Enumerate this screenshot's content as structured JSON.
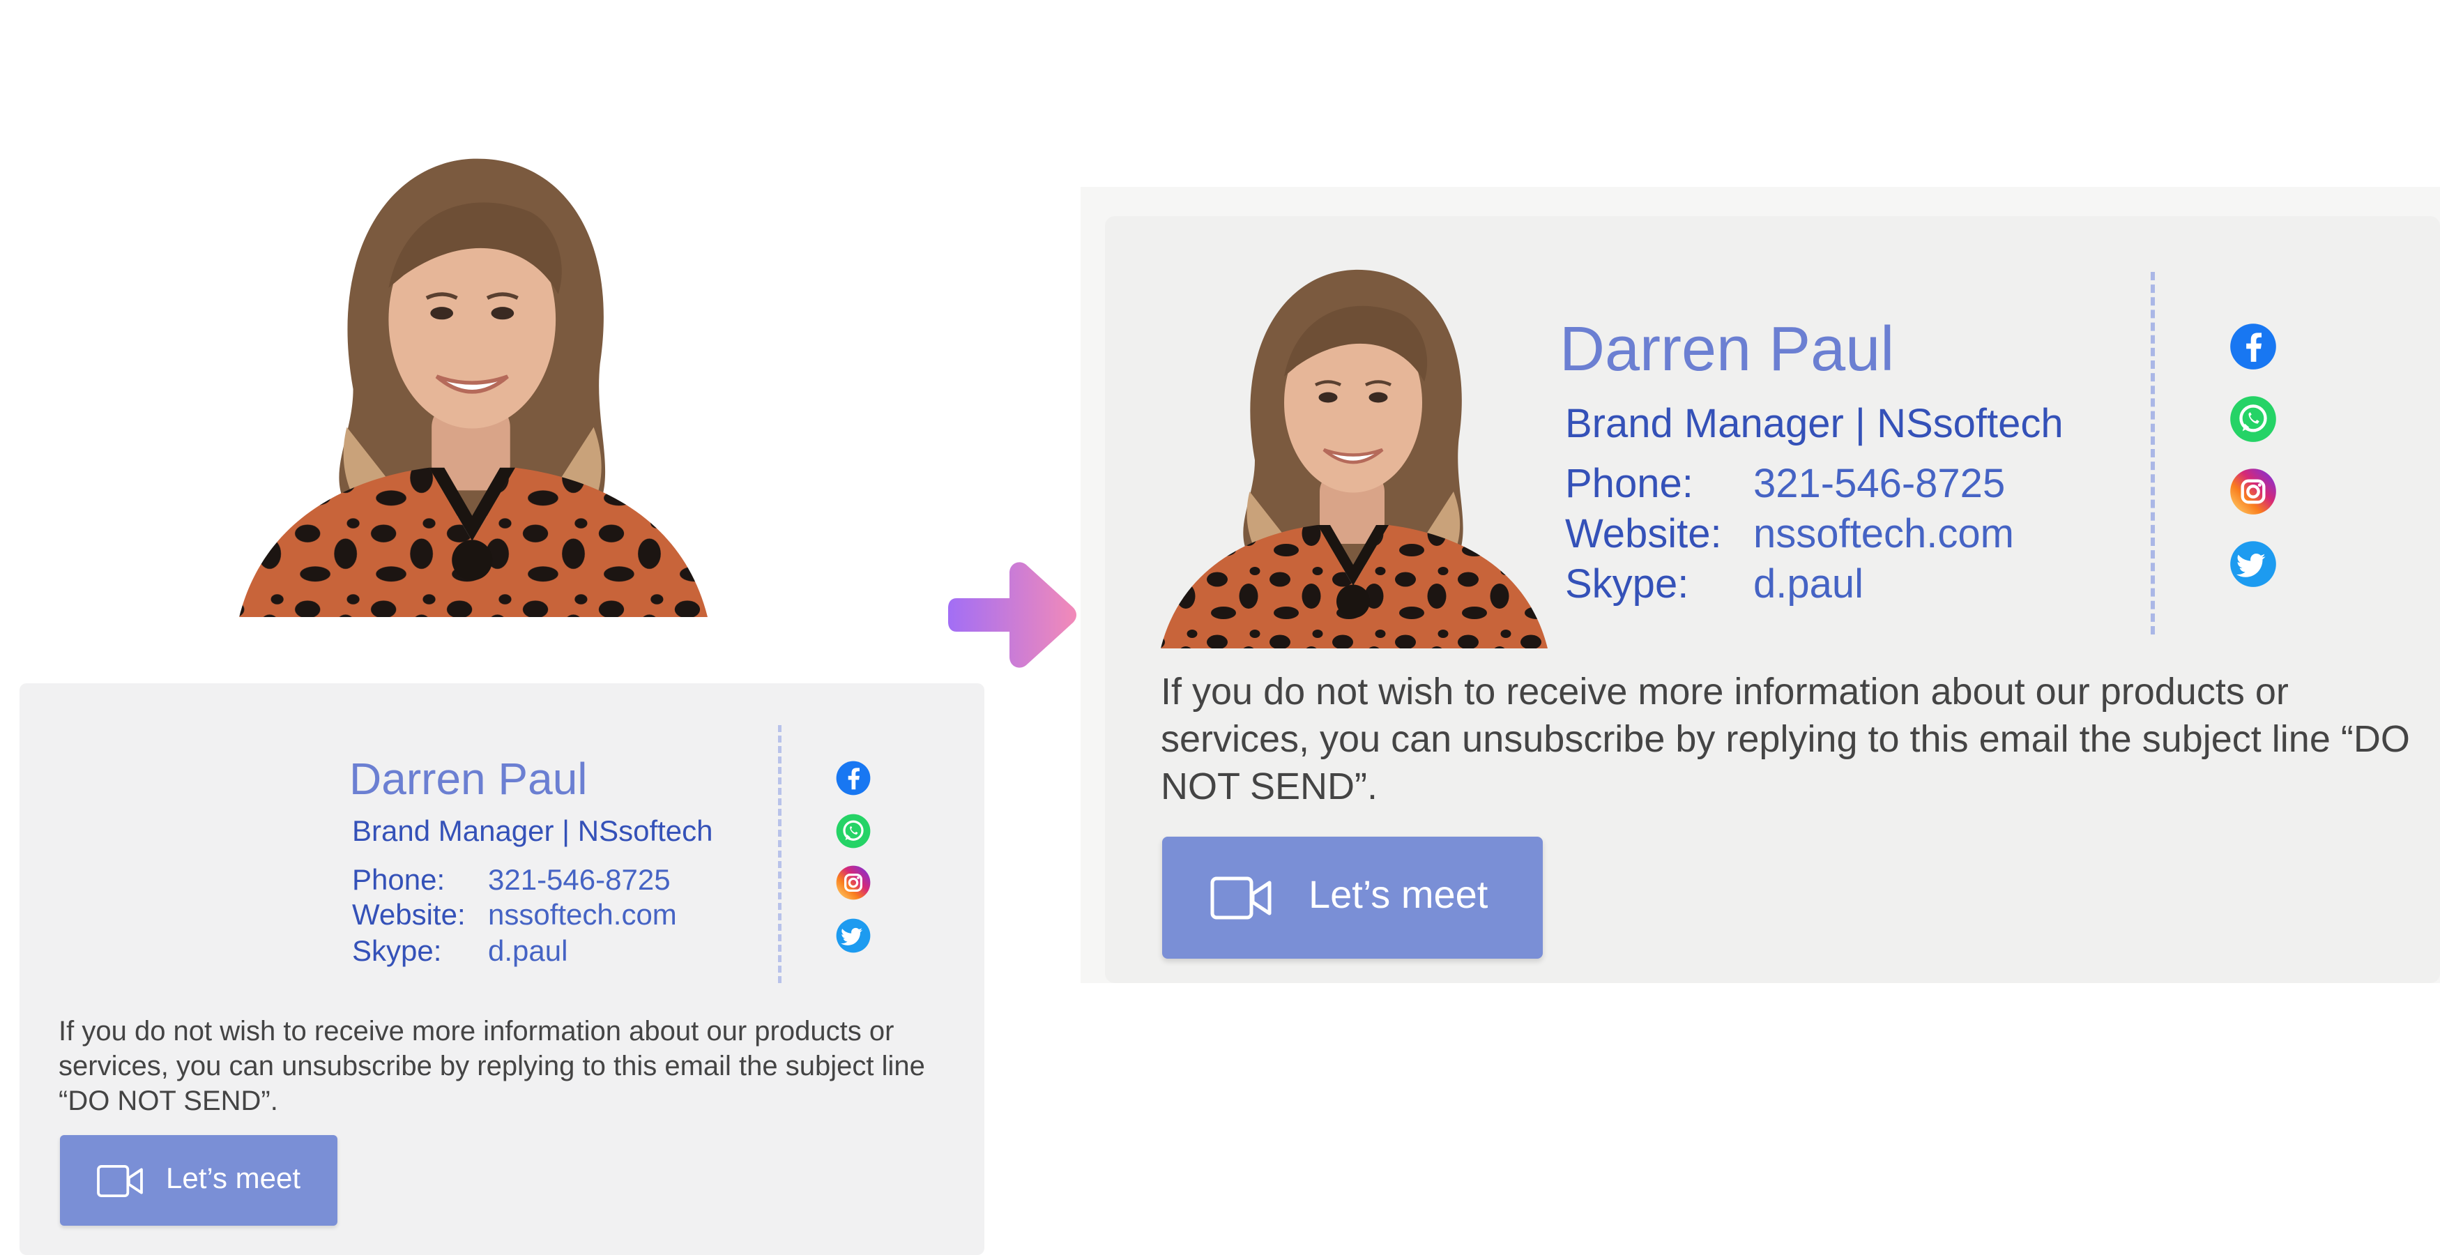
{
  "left_signature": {
    "name": "Darren Paul",
    "role": "Brand Manager  |  NSsoftech",
    "phone_label": "Phone:",
    "phone": "321-546-8725",
    "website_label": "Website:",
    "website": "nssoftech.com",
    "skype_label": "Skype:",
    "skype": "d.paul",
    "social_icons": [
      "facebook-icon",
      "whatsapp-icon",
      "instagram-icon",
      "twitter-icon"
    ],
    "disclaimer": "If you do not wish to receive more information about our products or services, you can unsubscribe by replying to this email the subject line “DO NOT SEND”.",
    "meet_button": "Let’s meet"
  },
  "right_signature": {
    "name": "Darren Paul",
    "role": "Brand Manager  |  NSsoftech",
    "phone_label": "Phone:",
    "phone": "321-546-8725",
    "website_label": "Website:",
    "website": "nssoftech.com",
    "skype_label": "Skype:",
    "skype": "d.paul",
    "social_icons": [
      "facebook-icon",
      "whatsapp-icon",
      "instagram-icon",
      "twitter-icon"
    ],
    "disclaimer": "If you do not wish to receive more information about our products or services, you can unsubscribe by replying to this email the subject line “DO NOT SEND”.",
    "meet_button": "Let’s meet"
  },
  "colors": {
    "name": "#6b7fd2",
    "label": "#3451b8",
    "button": "#7a8fd6",
    "card": "#f1f1f2",
    "arrow_start": "#a26ef5",
    "arrow_end": "#f28ab8"
  }
}
